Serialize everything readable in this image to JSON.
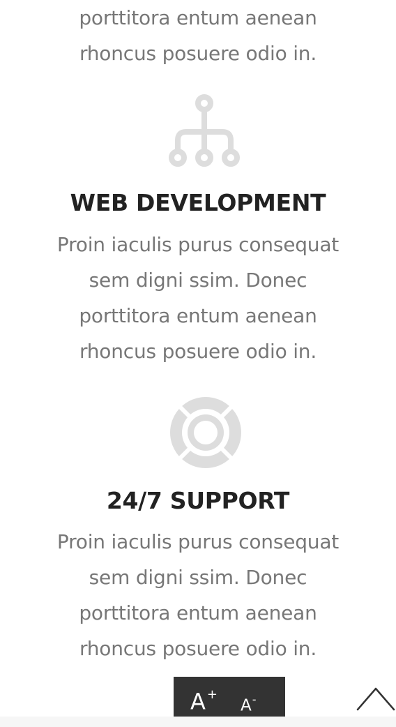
{
  "features": {
    "top": {
      "description_lines": [
        "porttitora entum aenean",
        "rhoncus posuere odio in."
      ]
    },
    "web_development": {
      "icon": "network-icon",
      "title": "WEB DEVELOPMENT",
      "description_lines": [
        "Proin iaculis purus consequat",
        "sem digni ssim. Donec",
        "porttitora entum aenean",
        "rhoncus posuere odio in."
      ]
    },
    "support": {
      "icon": "lifebuoy-icon",
      "title": "24/7 SUPPORT",
      "description_lines": [
        "Proin iaculis purus consequat",
        "sem digni ssim. Donec",
        "porttitora entum aenean",
        "rhoncus posuere odio in."
      ]
    }
  },
  "font_controls": {
    "increase_label": "A",
    "increase_sign": "+",
    "decrease_label": "A",
    "decrease_sign": "-"
  },
  "scroll_top": {
    "icon": "chevron-up-icon"
  },
  "colors": {
    "icon_gray": "#dddddd",
    "text_gray": "#777777",
    "title_dark": "#222222",
    "control_bg": "#333333"
  }
}
